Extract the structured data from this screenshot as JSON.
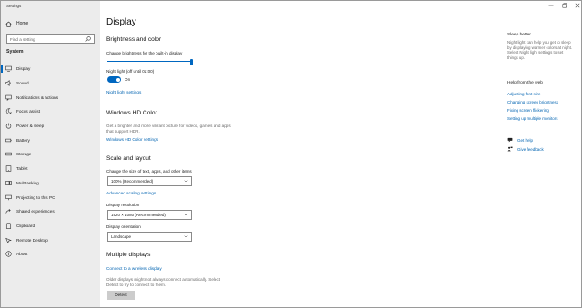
{
  "window": {
    "title": "Settings"
  },
  "sidebar": {
    "home_label": "Home",
    "search_placeholder": "Find a setting",
    "section_title": "System",
    "items": [
      {
        "label": "Display",
        "icon": "monitor-icon"
      },
      {
        "label": "Sound",
        "icon": "speaker-icon"
      },
      {
        "label": "Notifications & actions",
        "icon": "message-icon"
      },
      {
        "label": "Focus assist",
        "icon": "moon-icon"
      },
      {
        "label": "Power & sleep",
        "icon": "power-icon"
      },
      {
        "label": "Battery",
        "icon": "battery-icon"
      },
      {
        "label": "Storage",
        "icon": "storage-icon"
      },
      {
        "label": "Tablet",
        "icon": "tablet-icon"
      },
      {
        "label": "Multitasking",
        "icon": "multitask-icon"
      },
      {
        "label": "Projecting to this PC",
        "icon": "project-icon"
      },
      {
        "label": "Shared experiences",
        "icon": "share-icon"
      },
      {
        "label": "Clipboard",
        "icon": "clipboard-icon"
      },
      {
        "label": "Remote Desktop",
        "icon": "remote-icon"
      },
      {
        "label": "About",
        "icon": "info-icon"
      }
    ]
  },
  "main": {
    "title": "Display",
    "brightness": {
      "heading": "Brightness and color",
      "slider_label": "Change brightness for the built-in display",
      "brightness_level": 1.0,
      "night_light_label": "Night light (off until 01:00)",
      "toggle_state": "On",
      "settings_link": "Night light settings"
    },
    "hdcolor": {
      "heading": "Windows HD Color",
      "description_line1": "Get a brighter and more vibrant picture for videos, games and apps",
      "description_line2": "that support HDR.",
      "settings_link": "Windows HD Color settings"
    },
    "scale": {
      "heading": "Scale and layout",
      "size_label": "Change the size of text, apps, and other items",
      "size_value": "100% (Recommended)",
      "advanced_link": "Advanced scaling settings",
      "resolution_label": "Display resolution",
      "resolution_value": "1920 × 1080 (Recommended)",
      "orientation_label": "Display orientation",
      "orientation_value": "Landscape"
    },
    "multiple": {
      "heading": "Multiple displays",
      "connect_link": "Connect to a wireless display",
      "note_line1": "Older displays might not always connect automatically. Select",
      "note_line2": "Detect to try to connect to them.",
      "detect_button": "Detect"
    }
  },
  "aside": {
    "sleep_heading": "Sleep better",
    "sleep_text": "Night light can help you get to sleep by displaying warmer colors at night. Select Night light settings to set things up.",
    "web_heading": "Help from the web",
    "web_links": [
      "Adjusting font size",
      "Changing screen brightness",
      "Fixing screen flickering",
      "Setting up multiple monitors"
    ],
    "get_help": "Get help",
    "give_feedback": "Give feedback"
  },
  "colors": {
    "accent": "#0067c0",
    "link": "#0063b1",
    "sidebar_bg": "#ececec"
  }
}
